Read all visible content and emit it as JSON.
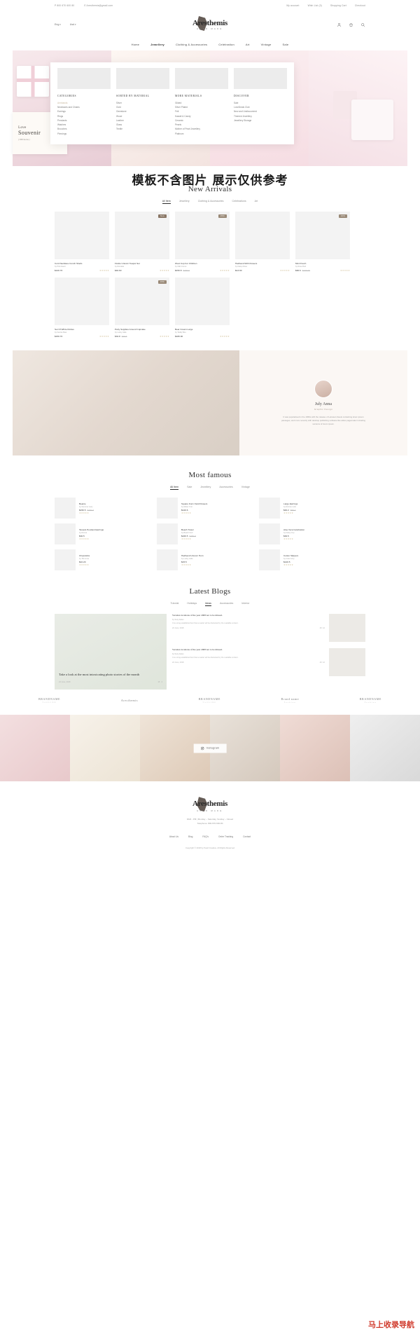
{
  "topbar": {
    "phone": "P 800 670 600 80",
    "email": "E Aresthemis@gmail.com",
    "links": [
      "My account",
      "Wish List (0)",
      "Shopping Cart",
      "Checkout"
    ]
  },
  "header": {
    "lang": "Eng",
    "currency": "Usd",
    "logo_name": "Aresthemis",
    "logo_sub": "HAND MADE",
    "icons": [
      "user-icon",
      "cart-icon",
      "search-icon"
    ]
  },
  "nav": {
    "items": [
      "Home",
      "Jewellery",
      "Clothing & Accessories",
      "Celebration",
      "Art",
      "Vintage",
      "Sale"
    ],
    "active": "Jewellery"
  },
  "megamenu": {
    "columns": [
      {
        "head": "CATEGORIES",
        "items": [
          "Armbands",
          "Necklaces and Chains",
          "Earrings",
          "Rings",
          "Pendants",
          "Watches",
          "Brooches",
          "Piercings"
        ],
        "highlight": "Armbands"
      },
      {
        "head": "SORTED BY MATERIAL",
        "items": [
          "Silver",
          "Gold",
          "Gemstone",
          "Wood",
          "Leather",
          "Glass",
          "Textile"
        ]
      },
      {
        "head": "MORE MATERIALS",
        "items": [
          "Gilded",
          "Silver Plated",
          "Felt",
          "Kawaii & Candy",
          "Ceramic",
          "Pearls",
          "Mother of Pearl Jewellery",
          "Platinum"
        ]
      },
      {
        "head": "DISCOVER",
        "items": [
          "Sale",
          "LoveDeals Club",
          "New and Undiscovered",
          "Themed Jewellery",
          "Jewellery Storage"
        ]
      }
    ]
  },
  "hero": {
    "card_line1": "Love",
    "card_line2": "Souvenir",
    "card_line3": "( 150 items )"
  },
  "watermark": "模板不含图片  展示仅供参考",
  "new_arrivals": {
    "title": "New Arrivals",
    "tabs": [
      "All Item",
      "Jewellery",
      "Clothing & Accessories",
      "Celebrations",
      "Art"
    ],
    "active_tab": "All Item",
    "products": [
      {
        "name": "Cord Necklace Conch Shells",
        "by": "by Pink Heart",
        "price": "$120.70",
        "old": "",
        "badge": "",
        "stars": "★★★★★"
      },
      {
        "name": "Flodte Unicorn Teapot Set",
        "by": "by Romaka",
        "price": "$40.60",
        "old": "",
        "badge": "New",
        "stars": "★★★★★"
      },
      {
        "name": "Wool Cup For Children",
        "by": "by Niki Crome",
        "price": "$150.8",
        "old": "$200.6",
        "badge": "25%",
        "stars": "★★★★★"
      },
      {
        "name": "Hairband With Flowers",
        "by": "by Daisy Muss",
        "price": "$13.90",
        "old": "",
        "badge": "",
        "stars": "★★★★★"
      },
      {
        "name": "Mini Pouch",
        "by": "by Rose Bud",
        "price": "$90.6",
        "old": "$100.60",
        "badge": "10%",
        "stars": "★★★★★"
      },
      {
        "name": "Set Of White Dishes",
        "by": "by Fannie Mae",
        "price": "$150.70",
        "old": "",
        "badge": "",
        "stars": "★★★★★"
      },
      {
        "name": "Party Supplies Around Cupcake",
        "by": "by Lucky Jade",
        "price": "$32.8",
        "old": "$40.6",
        "badge": "15%",
        "stars": "★★★★★"
      },
      {
        "name": "Bear Cream Large",
        "by": "by Teddy Boo",
        "price": "$180.90",
        "old": "",
        "badge": "",
        "stars": "★★★★★"
      }
    ]
  },
  "about": {
    "name": "July Anna",
    "role": "Graphic Design",
    "text": "It was popularised in the 1960s with the release of Letraset sheets containing lorem ipsum passages, and more recently with desktop publishing software like aldus pagemaker including versions of lorem ipsum."
  },
  "most_famous": {
    "title": "Most famous",
    "tabs": [
      "All Item",
      "Sale",
      "Jewellery",
      "Accessories",
      "Vintage"
    ],
    "active_tab": "All Item",
    "items": [
      {
        "name": "Beanie",
        "by": "by Summer Lazy",
        "price": "$150.5",
        "old": "$200.7",
        "stars": "★★★★★"
      },
      {
        "name": "Square Form Field Flowers",
        "by": "by Mister Knit",
        "price": "$120.6",
        "old": "",
        "stars": "★★★★★"
      },
      {
        "name": "Large Earrings",
        "by": "by Ronnie Lock",
        "price": "$40.2",
        "old": "$60.4",
        "stars": "★★★★★"
      },
      {
        "name": "Tassels Pendant Earrings",
        "by": "by Ronna",
        "price": "$30.5",
        "old": "",
        "stars": "★★★★★"
      },
      {
        "name": "Beach Towel",
        "by": "by Beach Surf",
        "price": "$220.5",
        "old": "$250.7",
        "stars": "★★★★★"
      },
      {
        "name": "Aloe Vera Celebration",
        "by": "by Daisy Cup",
        "price": "$30.5",
        "old": "",
        "stars": "★★★★★"
      },
      {
        "name": "Chopsticks",
        "by": "by Tiki Luna",
        "price": "$10.20",
        "old": "",
        "stars": "★★★★★"
      },
      {
        "name": "Hairband Unicorn Horn",
        "by": "by Lucky Jade",
        "price": "$15.5",
        "old": "",
        "stars": "★★★★★"
      },
      {
        "name": "Cotton Slippers",
        "by": "by Cute Cozy",
        "price": "$120.5",
        "old": "",
        "stars": "★★★★★"
      }
    ]
  },
  "blogs": {
    "title": "Latest Blogs",
    "tabs": [
      "Tutorial",
      "Holidays",
      "Ideas",
      "Accessories",
      "Interior"
    ],
    "active_tab": "Ideas",
    "main": {
      "title": "Take a look at the most intoxicating photo stories of the month",
      "date": "24 June, 2018",
      "likes": "15",
      "comments": "4"
    },
    "side": [
      {
        "title": "Vacation locations of the year 2008 not to be missed.",
        "by": "by Suzy Adam",
        "excerpt": "It is a long established fact that a reader will be distracted by the readable content.",
        "date": "22 June, 2018",
        "likes": "40",
        "comments": "12"
      },
      {
        "title": "Vacation locations of the year 2008 not to be missed.",
        "by": "by Suzy Adam",
        "excerpt": "It is a long established fact that a reader will be distracted by the readable content.",
        "date": "22 June, 2018",
        "likes": "40",
        "comments": "12"
      }
    ]
  },
  "brands": [
    {
      "name": "BRANDNAME",
      "sub": "TAGLINE"
    },
    {
      "name": "Aresthemis",
      "sub": ""
    },
    {
      "name": "BRANDNAME",
      "sub": "TAGLINE"
    },
    {
      "name": "Brand name",
      "sub": "Fashion"
    },
    {
      "name": "BRANDNAME",
      "sub": "Fashion"
    }
  ],
  "instagram": {
    "label": "Instagram",
    "icon": "instagram-icon"
  },
  "footer": {
    "logo_name": "Aresthemis",
    "logo_sub": "HAND MADE",
    "hours_line1": "8AM - PM | Monday – Saturday, Sunday – Closed",
    "hours_line2": "Telephone: 800-670-600-80",
    "nav": [
      "About Us",
      "Blog",
      "FAQ's",
      "Order Tracking",
      "Contact"
    ],
    "copyright": "Copyright © 2018 by Pearl Creative. All Rights Reserved"
  },
  "site_watermark": "马上收录导航"
}
